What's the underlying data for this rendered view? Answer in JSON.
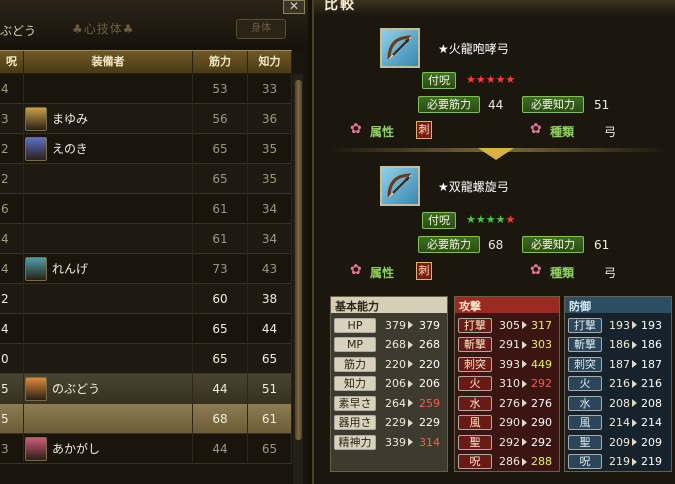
{
  "left_panel": {
    "title": "ぶどう",
    "subtitle": "♣心技体♣",
    "button_label": "身体",
    "close_label": "✕",
    "columns": [
      "呪",
      "装備者",
      "筋力",
      "知力"
    ],
    "rows": [
      {
        "col1": "4",
        "name": "",
        "str": "53",
        "int": "33",
        "avatar": ""
      },
      {
        "col1": "3",
        "name": "まゆみ",
        "str": "56",
        "int": "36",
        "avatar": "#c8a044"
      },
      {
        "col1": "2",
        "name": "えのき",
        "str": "65",
        "int": "35",
        "avatar": "#5b6ec8"
      },
      {
        "col1": "2",
        "name": "",
        "str": "65",
        "int": "35",
        "avatar": ""
      },
      {
        "col1": "6",
        "name": "",
        "str": "61",
        "int": "34",
        "avatar": ""
      },
      {
        "col1": "4",
        "name": "",
        "str": "61",
        "int": "34",
        "avatar": ""
      },
      {
        "col1": "4",
        "name": "れんげ",
        "str": "73",
        "int": "43",
        "avatar": "#4aa0a8"
      },
      {
        "col1": "2",
        "name": "",
        "str": "60",
        "int": "38",
        "avatar": ""
      },
      {
        "col1": "4",
        "name": "",
        "str": "65",
        "int": "44",
        "avatar": ""
      },
      {
        "col1": "0",
        "name": "",
        "str": "65",
        "int": "65",
        "avatar": ""
      },
      {
        "col1": "5",
        "name": "のぶどう",
        "str": "44",
        "int": "51",
        "avatar": "#e08a3a"
      },
      {
        "col1": "5",
        "name": "",
        "str": "68",
        "int": "61",
        "avatar": ""
      },
      {
        "col1": "3",
        "name": "あかがし",
        "str": "44",
        "int": "65",
        "avatar": "#d05a7a"
      }
    ]
  },
  "right_panel": {
    "title": "比較",
    "weapons": [
      {
        "name": "★火龍咆哮弓",
        "rating_label": "付呪",
        "stars": "★★★★★",
        "req_str_label": "必要筋力",
        "req_str": "44",
        "req_int_label": "必要知力",
        "req_int": "51",
        "attr_label": "属性",
        "attr_value": "刺",
        "kind_label": "種類",
        "kind_value": "弓"
      },
      {
        "name": "★双龍螺旋弓",
        "rating_label": "付呪",
        "stars": "★★★★★",
        "req_str_label": "必要筋力",
        "req_str": "68",
        "req_int_label": "必要知力",
        "req_int": "61",
        "attr_label": "属性",
        "attr_value": "刺",
        "kind_label": "種類",
        "kind_value": "弓"
      }
    ],
    "stats": {
      "basic": {
        "title": "基本能力",
        "rows": [
          {
            "key": "HP",
            "a": "379",
            "b": "379",
            "dir": "same"
          },
          {
            "key": "MP",
            "a": "268",
            "b": "268",
            "dir": "same"
          },
          {
            "key": "筋力",
            "a": "220",
            "b": "220",
            "dir": "same"
          },
          {
            "key": "知力",
            "a": "206",
            "b": "206",
            "dir": "same"
          },
          {
            "key": "素早さ",
            "a": "264",
            "b": "259",
            "dir": "down"
          },
          {
            "key": "器用さ",
            "a": "229",
            "b": "229",
            "dir": "same"
          },
          {
            "key": "精神力",
            "a": "339",
            "b": "314",
            "dir": "down"
          }
        ]
      },
      "attack": {
        "title": "攻撃",
        "rows": [
          {
            "key": "打撃",
            "a": "305",
            "b": "317",
            "dir": "up"
          },
          {
            "key": "斬撃",
            "a": "291",
            "b": "303",
            "dir": "up"
          },
          {
            "key": "刺突",
            "a": "393",
            "b": "449",
            "dir": "up"
          },
          {
            "key": "火",
            "a": "310",
            "b": "292",
            "dir": "down"
          },
          {
            "key": "水",
            "a": "276",
            "b": "276",
            "dir": "same"
          },
          {
            "key": "風",
            "a": "290",
            "b": "290",
            "dir": "same"
          },
          {
            "key": "聖",
            "a": "292",
            "b": "292",
            "dir": "same"
          },
          {
            "key": "呪",
            "a": "286",
            "b": "288",
            "dir": "up"
          }
        ]
      },
      "defense": {
        "title": "防御",
        "rows": [
          {
            "key": "打撃",
            "a": "193",
            "b": "193",
            "dir": "same"
          },
          {
            "key": "斬撃",
            "a": "186",
            "b": "186",
            "dir": "same"
          },
          {
            "key": "刺突",
            "a": "187",
            "b": "187",
            "dir": "same"
          },
          {
            "key": "火",
            "a": "216",
            "b": "216",
            "dir": "same"
          },
          {
            "key": "水",
            "a": "208",
            "b": "208",
            "dir": "same"
          },
          {
            "key": "風",
            "a": "214",
            "b": "214",
            "dir": "same"
          },
          {
            "key": "聖",
            "a": "209",
            "b": "209",
            "dir": "same"
          },
          {
            "key": "呪",
            "a": "219",
            "b": "219",
            "dir": "same"
          }
        ]
      }
    }
  }
}
